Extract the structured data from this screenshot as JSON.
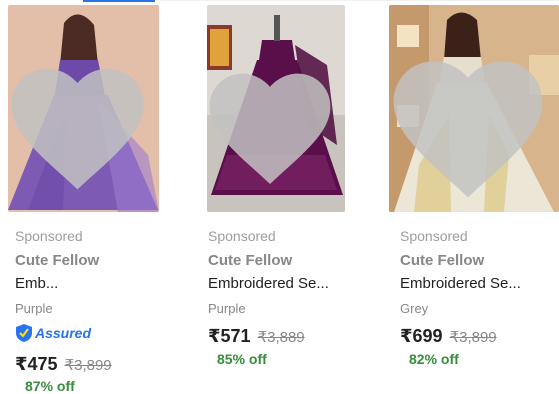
{
  "products": [
    {
      "sponsored": "Sponsored",
      "brand": "Cute Fellow",
      "title": "Emb...",
      "variant": "Purple",
      "assured_label": "Assured",
      "price": "₹475",
      "mrp": "₹3,899",
      "discount": "87% off",
      "image": {
        "dress_color": "#7d5bb5",
        "bg_color": "#e9c9b6"
      }
    },
    {
      "sponsored": "Sponsored",
      "brand": "Cute Fellow",
      "title": "Embroidered Se...",
      "variant": "Purple",
      "price": "₹571",
      "mrp": "₹3,889",
      "discount": "85% off",
      "image": {
        "dress_color": "#5b0f4a",
        "bg_color": "#ddd8d2"
      }
    },
    {
      "sponsored": "Sponsored",
      "brand": "Cute Fellow",
      "title": "Embroidered Se...",
      "variant": "Grey",
      "price": "₹699",
      "mrp": "₹3,899",
      "discount": "82% off",
      "image": {
        "dress_color": "#ece6d6",
        "bg_color": "#d7b48c"
      }
    }
  ],
  "icons": {
    "wishlist": "heart-icon",
    "assured": "assured-shield-icon"
  },
  "colors": {
    "accent": "#2874f0",
    "discount": "#388e3c",
    "heart": "#c2c2c2"
  }
}
